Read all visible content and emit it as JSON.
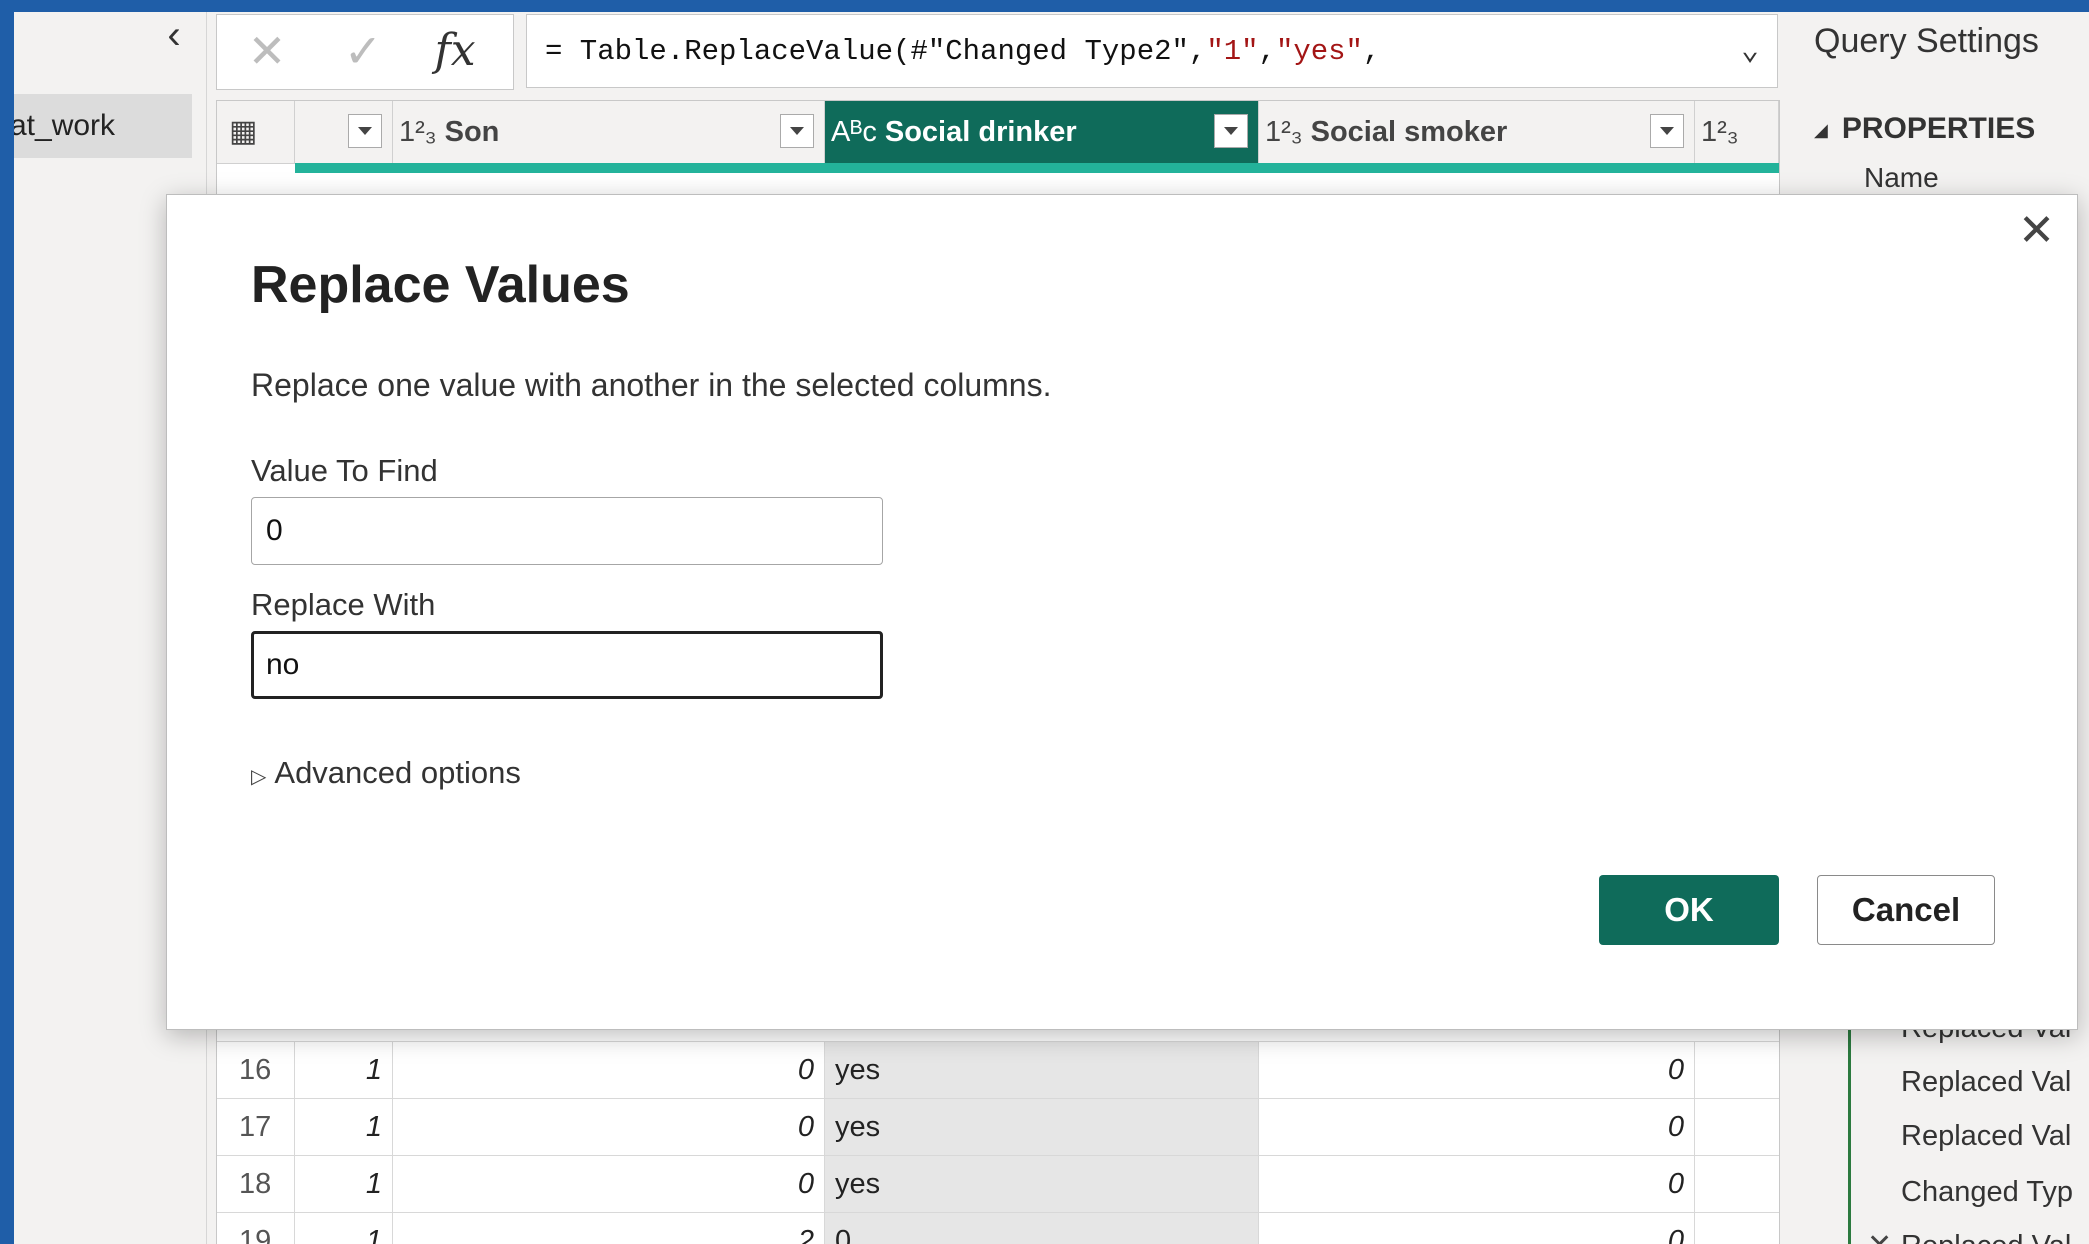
{
  "query_pane": {
    "collapse_glyph": "‹",
    "selected_query": "at_work"
  },
  "formula_bar": {
    "cancel_glyph": "✕",
    "commit_glyph": "✓",
    "fx_label": "fx",
    "prefix": "= Table.ReplaceValue(#\"Changed Type2\",",
    "arg1": "\"1\"",
    "sep": ",",
    "arg2": "\"yes\"",
    "suffix": ",",
    "expand_glyph": "⌄"
  },
  "grid": {
    "columns": [
      {
        "type": "1²₃",
        "name": "Son"
      },
      {
        "type": "Aᴮc",
        "name": "Social drinker"
      },
      {
        "type": "1²₃",
        "name": "Social smoker"
      },
      {
        "type": "1²₃",
        "name": ""
      }
    ],
    "rows": [
      {
        "n": "16",
        "c1": "1",
        "son": "0",
        "drinker": "yes",
        "smoker": "0"
      },
      {
        "n": "17",
        "c1": "1",
        "son": "0",
        "drinker": "yes",
        "smoker": "0"
      },
      {
        "n": "18",
        "c1": "1",
        "son": "0",
        "drinker": "yes",
        "smoker": "0"
      },
      {
        "n": "19",
        "c1": "1",
        "son": "2",
        "drinker": "0",
        "smoker": "0"
      }
    ]
  },
  "settings": {
    "title": "Query Settings",
    "properties": "PROPERTIES",
    "name_label": "Name",
    "steps": [
      "Replaced Val",
      "Replaced Val",
      "Replaced Val",
      "Changed Typ",
      "Replaced Val"
    ]
  },
  "dialog": {
    "title": "Replace Values",
    "description": "Replace one value with another in the selected columns.",
    "find_label": "Value To Find",
    "find_value": "0",
    "replace_label": "Replace With",
    "replace_value": "no",
    "advanced": "Advanced options",
    "ok": "OK",
    "cancel": "Cancel",
    "close_glyph": "✕"
  },
  "colors": {
    "accent": "#0f6b5a",
    "quality_bar": "#23b29a",
    "frame": "#1f5ea8"
  }
}
